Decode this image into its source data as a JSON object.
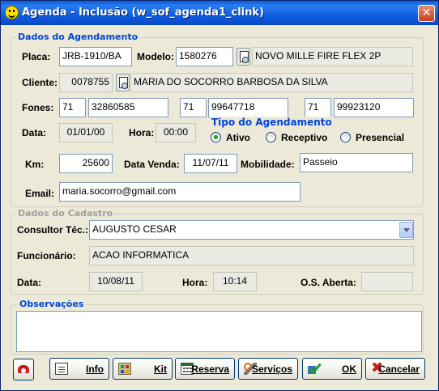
{
  "window": {
    "title": "Agenda - Inclusão (w_sof_agenda1_clink)",
    "close_glyph": "✕"
  },
  "agendamento": {
    "legend": "Dados do Agendamento",
    "placa_label": "Placa:",
    "placa": "JRB-1910/BA",
    "modelo_label": "Modelo:",
    "modelo_codigo": "1580276",
    "modelo_desc": "NOVO MILLE FIRE FLEX 2P",
    "cliente_label": "Cliente:",
    "cliente_codigo": "0078755",
    "cliente_nome": "MARIA  DO SOCORRO BARBOSA DA SILVA",
    "fones_label": "Fones:",
    "fones": [
      {
        "ddd": "71",
        "numero": "32860585"
      },
      {
        "ddd": "71",
        "numero": "99647718"
      },
      {
        "ddd": "71",
        "numero": "99923120"
      }
    ],
    "data_label": "Data:",
    "data": "01/01/00",
    "hora_label": "Hora:",
    "hora": "00:00",
    "tipo_label": "Tipo do Agendamento",
    "tipo_options": [
      "Ativo",
      "Receptivo",
      "Presencial"
    ],
    "tipo_selected": "Ativo",
    "km_label": "Km:",
    "km": "25600",
    "data_venda_label": "Data Venda:",
    "data_venda": "11/07/11",
    "mobilidade_label": "Mobilidade:",
    "mobilidade": "Passeio",
    "email_label": "Email:",
    "email": "maria.socorro@gmail.com"
  },
  "cadastro": {
    "legend": "Dados do Cadastro",
    "consultor_label": "Consultor Téc.:",
    "consultor": "AUGUSTO CESAR",
    "funcionario_label": "Funcionário:",
    "funcionario": "ACAO INFORMATICA",
    "data_label": "Data:",
    "data": "10/08/11",
    "hora_label": "Hora:",
    "hora": "10:14",
    "os_label": "O.S. Aberta:",
    "os": ""
  },
  "observacoes": {
    "legend": "Observações",
    "text": ""
  },
  "buttons": {
    "info": "Info",
    "kit": "Kit",
    "reserva": "Reserva",
    "servicos": "Serviços",
    "ok": "OK",
    "cancelar": "Cancelar"
  },
  "icons": {
    "title": "smiley-icon",
    "phone": "phone-icon",
    "info": "document-icon",
    "kit": "kit-icon",
    "reserva": "calendar-icon",
    "servicos": "tools-icon",
    "ok": "check-icon",
    "cancelar": "x-icon"
  }
}
